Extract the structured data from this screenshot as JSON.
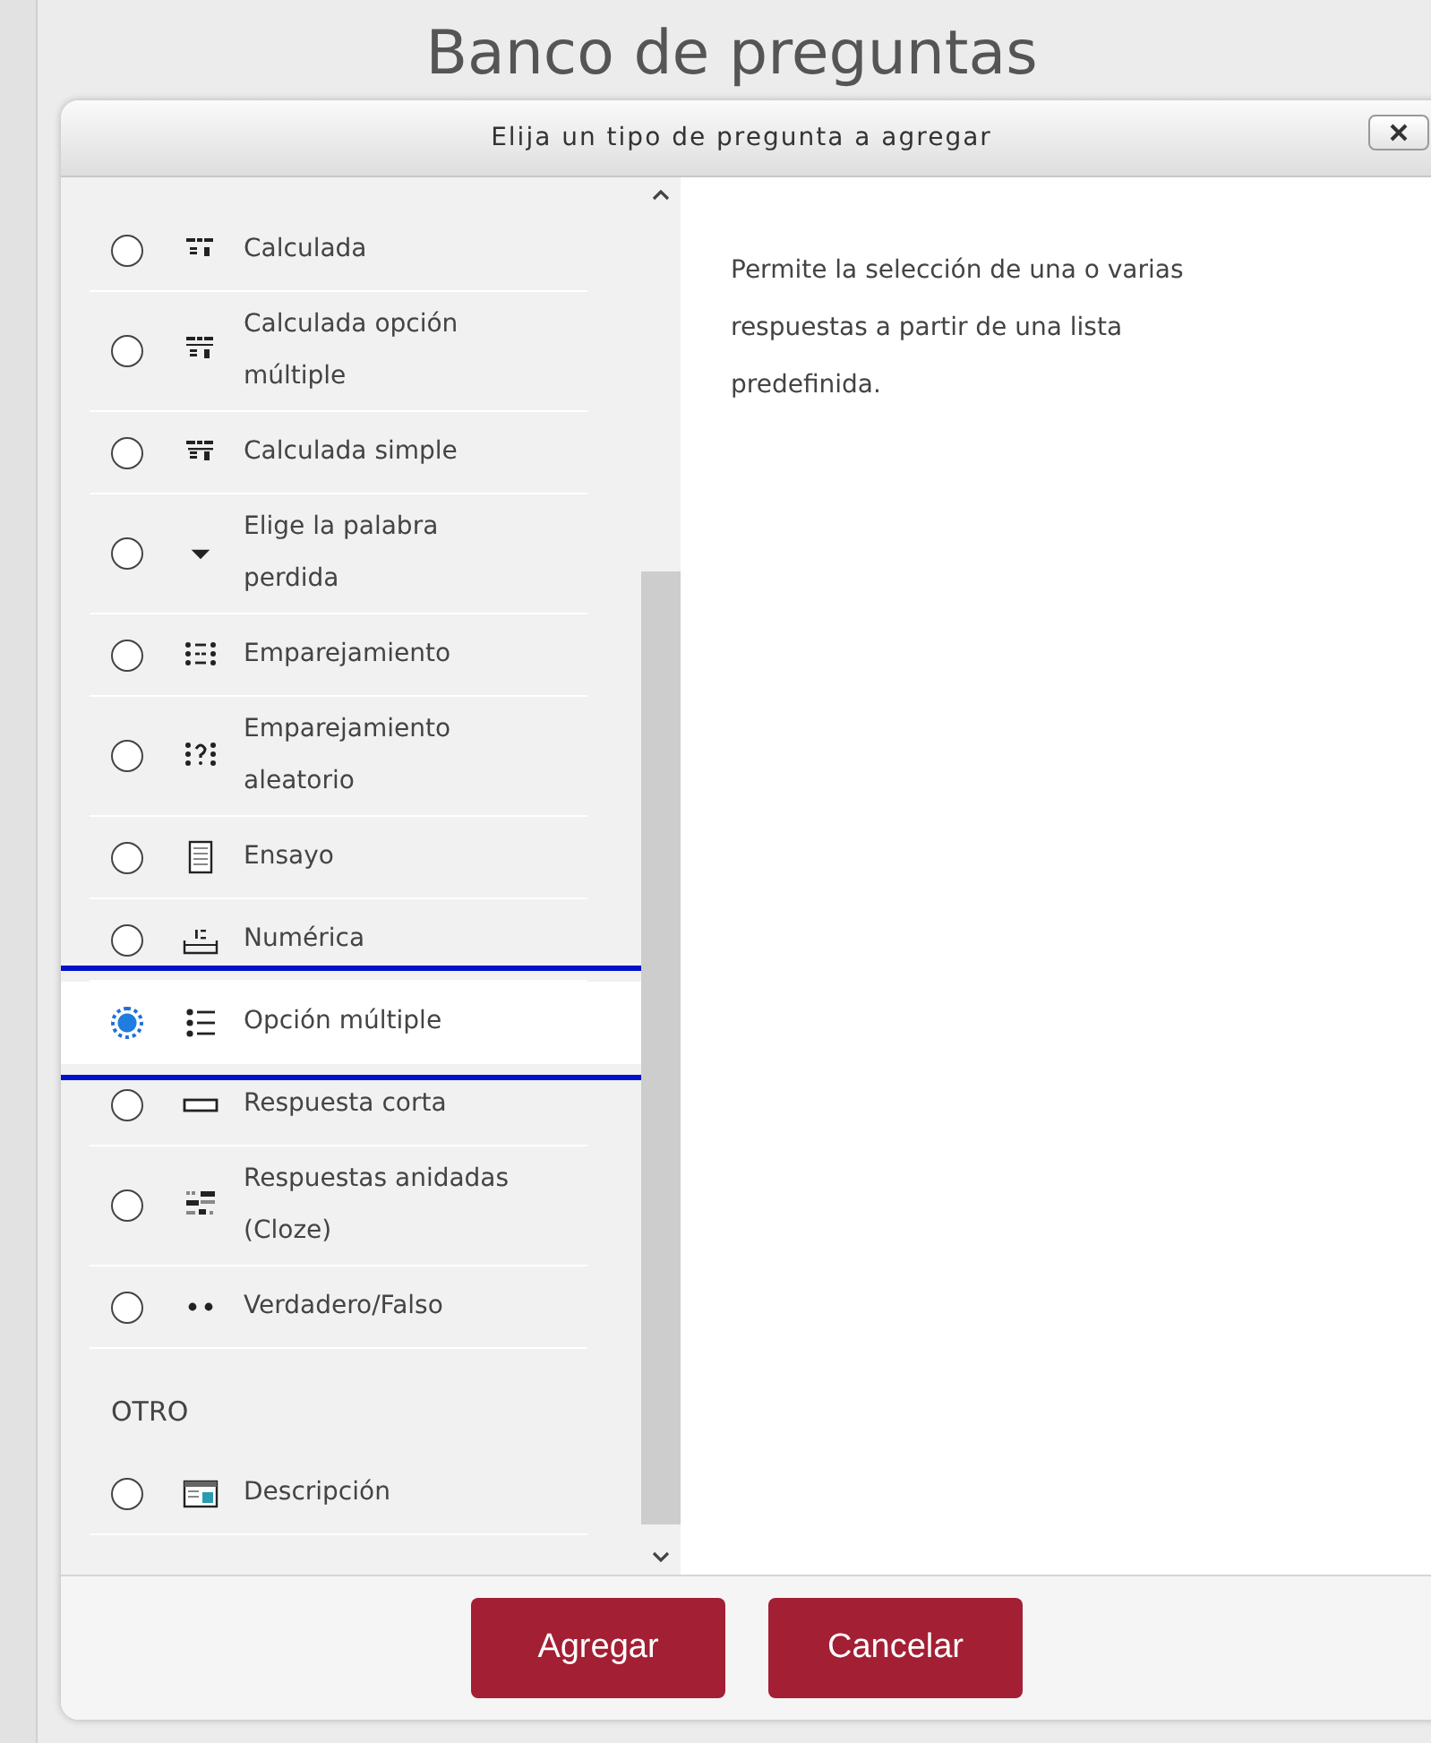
{
  "page": {
    "title": "Banco de preguntas"
  },
  "dialog": {
    "title": "Elija un tipo de pregunta a agregar",
    "sections": [
      {
        "items": [
          {
            "kind": "calculated",
            "label": "Calculada",
            "selected": false
          },
          {
            "kind": "calculatedmulti",
            "label": "Calculada opción múltiple",
            "selected": false
          },
          {
            "kind": "calculatedsimple",
            "label": "Calculada simple",
            "selected": false
          },
          {
            "kind": "gapselect",
            "label": "Elige la palabra perdida",
            "selected": false
          },
          {
            "kind": "match",
            "label": "Emparejamiento",
            "selected": false
          },
          {
            "kind": "randomsamatch",
            "label": "Emparejamiento aleatorio",
            "selected": false
          },
          {
            "kind": "essay",
            "label": "Ensayo",
            "selected": false
          },
          {
            "kind": "numerical",
            "label": "Numérica",
            "selected": false
          },
          {
            "kind": "multichoice",
            "label": "Opción múltiple",
            "selected": true
          },
          {
            "kind": "shortanswer",
            "label": "Respuesta corta",
            "selected": false
          },
          {
            "kind": "multianswer",
            "label": "Respuestas anidadas (Cloze)",
            "selected": false
          },
          {
            "kind": "truefalse",
            "label": "Verdadero/Falso",
            "selected": false
          }
        ]
      },
      {
        "heading": "OTRO",
        "items": [
          {
            "kind": "description",
            "label": "Descripción",
            "selected": false
          }
        ]
      }
    ],
    "description": "Permite la selección de una o varias respuestas a partir de una lista predefinida.",
    "buttons": [
      "Agregar",
      "Cancelar"
    ]
  }
}
